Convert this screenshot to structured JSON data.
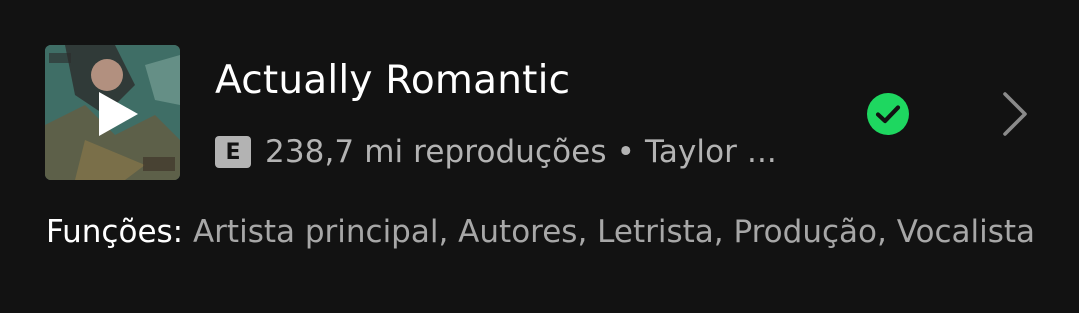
{
  "track": {
    "title": "Actually Romantic",
    "explicit_badge": "E",
    "plays_and_artist": "238,7 mi reproduções • Taylor ...",
    "saved": true
  },
  "roles": {
    "label": "Funções:",
    "values": "Artista principal, Autores, Letrista, Produção, Vocalista"
  },
  "icons": {
    "play": "play-icon",
    "check": "check-circle-icon",
    "chevron": "chevron-right-icon"
  },
  "colors": {
    "background": "#121212",
    "accent_green": "#1ed760",
    "secondary_text": "#b3b3b3"
  }
}
